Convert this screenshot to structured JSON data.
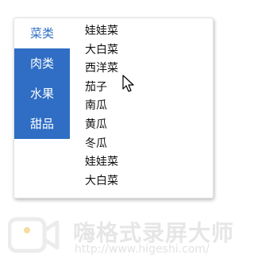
{
  "categories": [
    {
      "label": "菜类",
      "active": true
    },
    {
      "label": "肉类",
      "active": false
    },
    {
      "label": "水果",
      "active": false
    },
    {
      "label": "甜品",
      "active": false
    }
  ],
  "subitems": [
    "娃娃菜",
    "大白菜",
    "西洋菜",
    "茄子",
    "南瓜",
    "黄瓜",
    "冬瓜",
    "娃娃菜",
    "大白菜"
  ],
  "watermark": {
    "title": "嗨格式录屏大师",
    "url": "http://www.higeshi.com/"
  },
  "colors": {
    "accent": "#2f6ec4",
    "panel_bg": "#ffffff",
    "watermark": "#e6e6e6"
  },
  "icons": {
    "cursor": "arrow-cursor-icon",
    "logo": "camera-logo-icon"
  }
}
